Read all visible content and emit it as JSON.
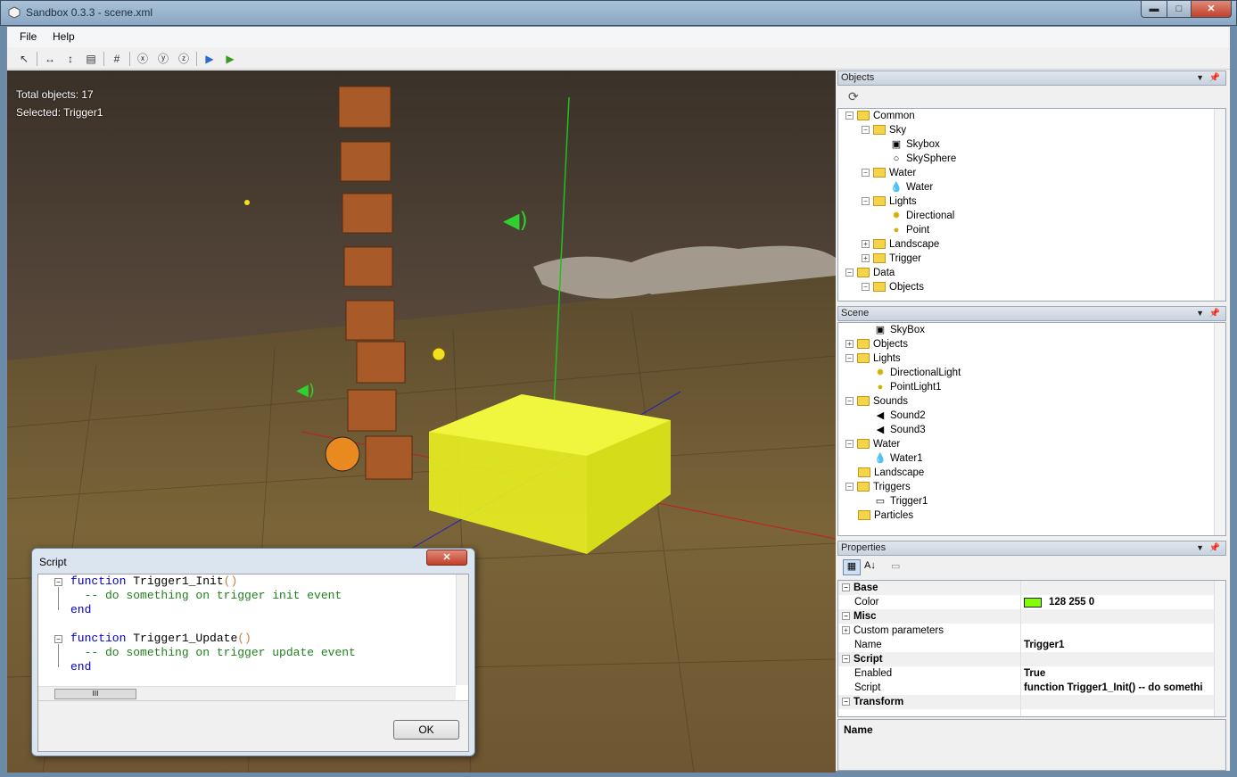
{
  "window": {
    "title": "Sandbox 0.3.3 - scene.xml",
    "min": "▬",
    "max": "□",
    "close": "✕"
  },
  "menu": {
    "file": "File",
    "help": "Help"
  },
  "toolbar": {
    "icons": [
      "select-arrow",
      "move-x",
      "move-y",
      "frame",
      "grid",
      "rotate-x",
      "rotate-y",
      "rotate-z",
      "play",
      "run"
    ]
  },
  "viewport": {
    "total_objects": "Total objects: 17",
    "selected": "Selected: Trigger1"
  },
  "objects_panel": {
    "title": "Objects",
    "items": [
      {
        "label": "Common"
      },
      {
        "label": "Sky"
      },
      {
        "label": "Skybox"
      },
      {
        "label": "SkySphere"
      },
      {
        "label": "Water"
      },
      {
        "label": "Water"
      },
      {
        "label": "Lights"
      },
      {
        "label": "Directional"
      },
      {
        "label": "Point"
      },
      {
        "label": "Landscape"
      },
      {
        "label": "Trigger"
      },
      {
        "label": "Data"
      },
      {
        "label": "Objects"
      }
    ]
  },
  "scene_panel": {
    "title": "Scene",
    "items": [
      {
        "label": "SkyBox"
      },
      {
        "label": "Objects"
      },
      {
        "label": "Lights"
      },
      {
        "label": "DirectionalLight"
      },
      {
        "label": "PointLight1"
      },
      {
        "label": "Sounds"
      },
      {
        "label": "Sound2"
      },
      {
        "label": "Sound3"
      },
      {
        "label": "Water"
      },
      {
        "label": "Water1"
      },
      {
        "label": "Landscape"
      },
      {
        "label": "Triggers"
      },
      {
        "label": "Trigger1"
      },
      {
        "label": "Particles"
      }
    ]
  },
  "properties_panel": {
    "title": "Properties",
    "cat_base": "Base",
    "color_label": "Color",
    "color_value": "128 255 0",
    "color_swatch": "#80ff00",
    "cat_misc": "Misc",
    "custom_params": "Custom parameters",
    "name_label": "Name",
    "name_value": "Trigger1",
    "cat_script": "Script",
    "enabled_label": "Enabled",
    "enabled_value": "True",
    "script_label": "Script",
    "script_value": "function Trigger1_Init()  -- do somethi",
    "cat_transform": "Transform",
    "desc_title": "Name"
  },
  "script_dialog": {
    "title": "Script",
    "close": "✕",
    "ok": "OK",
    "line1_kw": "function",
    "line1_name": " Trigger1_Init",
    "line1_paren": "()",
    "line2": "  -- do something on trigger init event",
    "line3": "end",
    "line5_kw": "function",
    "line5_name": " Trigger1_Update",
    "line5_paren": "()",
    "line6": "  -- do something on trigger update event",
    "line7": "end",
    "hscroll_grip": "III"
  }
}
